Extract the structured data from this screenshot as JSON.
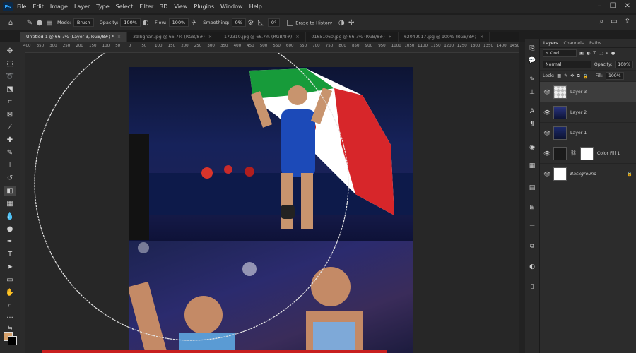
{
  "menubar": {
    "app_logo": "Ps",
    "items": [
      "File",
      "Edit",
      "Image",
      "Layer",
      "Type",
      "Select",
      "Filter",
      "3D",
      "View",
      "Plugins",
      "Window",
      "Help"
    ]
  },
  "options": {
    "mode_label": "Mode:",
    "mode_value": "Brush",
    "opacity_label": "Opacity:",
    "opacity_value": "100%",
    "flow_label": "Flow:",
    "flow_value": "100%",
    "smoothing_label": "Smoothing:",
    "smoothing_value": "0%",
    "angle_value": "0°",
    "erase_history_label": "Erase to History"
  },
  "tabs": [
    {
      "label": "Untitled-1 @ 66.7% (Layer 3, RGB/8#) *",
      "active": true
    },
    {
      "label": "3dlbgnan.jpg @ 66.7% (RGB/8#)",
      "active": false
    },
    {
      "label": "172310.jpg @ 66.7% (RGB/8#)",
      "active": false
    },
    {
      "label": "01651060.jpg @ 66.7% (RGB/8#)",
      "active": false
    },
    {
      "label": "62049017.jpg @ 100% (RGB/8#)",
      "active": false
    }
  ],
  "ruler": {
    "ticks": [
      "400",
      "350",
      "300",
      "250",
      "200",
      "150",
      "100",
      "50",
      "0",
      "50",
      "100",
      "150",
      "200",
      "250",
      "300",
      "350",
      "400",
      "450",
      "500",
      "550",
      "600",
      "650",
      "700",
      "750",
      "800",
      "850",
      "900",
      "950",
      "1000",
      "1050",
      "1100",
      "1150",
      "1200",
      "1250",
      "1300",
      "1350",
      "1400",
      "1450"
    ]
  },
  "panel": {
    "tabs": [
      "Layers",
      "Channels",
      "Paths"
    ],
    "filter_kind": "Kind",
    "blend_mode": "Normal",
    "opacity_label": "Opacity:",
    "opacity_value": "100%",
    "lock_label": "Lock:",
    "fill_label": "Fill:",
    "fill_value": "100%",
    "layers": [
      {
        "name": "Layer 3",
        "active": true
      },
      {
        "name": "Layer 2",
        "active": false
      },
      {
        "name": "Layer 1",
        "active": false
      },
      {
        "name": "Color Fill 1",
        "active": false
      },
      {
        "name": "Background",
        "active": false
      }
    ]
  },
  "colors": {
    "foreground": "#d6a06a",
    "background": "#000000",
    "accent_blue": "#31a8ff"
  }
}
